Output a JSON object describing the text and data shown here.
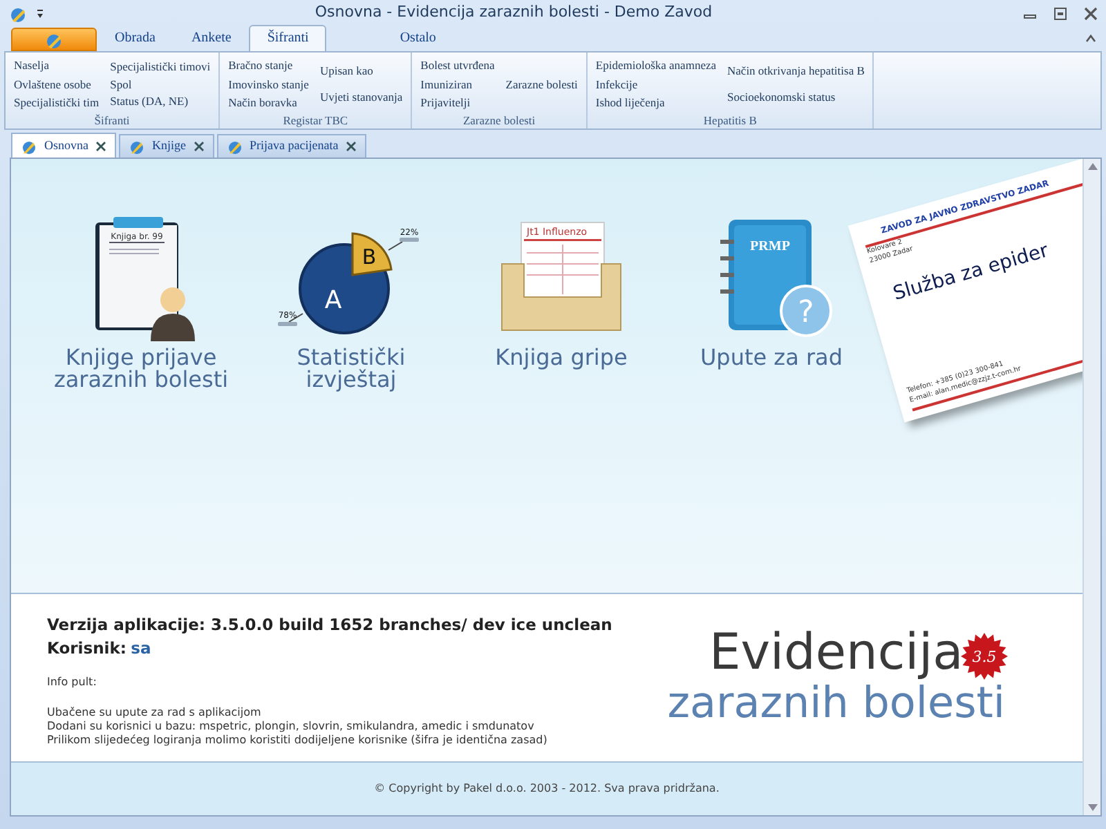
{
  "window": {
    "title": "Osnovna - Evidencija zaraznih bolesti - Demo Zavod"
  },
  "ribbon": {
    "tabs": [
      {
        "label": "Obrada",
        "selected": false
      },
      {
        "label": "Ankete",
        "selected": false
      },
      {
        "label": "Šifranti",
        "selected": true
      },
      {
        "label": "Ostalo",
        "selected": false
      }
    ],
    "groups": [
      {
        "label": "Šifranti",
        "columns": [
          [
            "Naselja",
            "Ovlaštene osobe",
            "Specijalistički tim"
          ],
          [
            "Specijalistički timovi",
            "Spol",
            "Status (DA, NE)"
          ]
        ]
      },
      {
        "label": "Registar TBC",
        "columns": [
          [
            "Bračno stanje",
            "Imovinsko stanje",
            "Način boravka"
          ],
          [
            "Upisan kao",
            "Uvjeti stanovanja"
          ]
        ]
      },
      {
        "label": "Zarazne bolesti",
        "columns": [
          [
            "Bolest utvrđena",
            "Imuniziran",
            "Prijavitelji"
          ],
          [
            "Zarazne bolesti"
          ]
        ]
      },
      {
        "label": "Hepatitis B",
        "columns": [
          [
            "Epidemiološka anamneza",
            "Infekcije",
            "Ishod liječenja"
          ],
          [
            "Način otkrivanja hepatitisa B",
            "Socioekonomski status"
          ]
        ]
      }
    ]
  },
  "document_tabs": [
    {
      "label": "Osnovna",
      "selected": true
    },
    {
      "label": "Knjige",
      "selected": false
    },
    {
      "label": "Prijava pacijenata",
      "selected": false
    }
  ],
  "tiles": [
    {
      "kind": "clipboard",
      "lines": [
        "Knjige prijave",
        "zaraznih bolesti"
      ],
      "icon_texts": [
        "Knjiga br. 99"
      ]
    },
    {
      "kind": "pie",
      "lines": [
        "Statistički",
        "izvještaj"
      ],
      "icon_texts": [
        "A",
        "B",
        "22%",
        "78%"
      ]
    },
    {
      "kind": "filebox",
      "lines": [
        "Knjiga gripe"
      ],
      "icon_texts": [
        "Jt1 Influenzo"
      ]
    },
    {
      "kind": "book",
      "lines": [
        "Upute za rad"
      ],
      "icon_texts": [
        "PRMP",
        "?"
      ]
    }
  ],
  "card": {
    "organization": "ZAVOD ZA JAVNO ZDRAVSTVO ZADAR",
    "address": [
      "Kolovare 2",
      "23000 Zadar"
    ],
    "headline": "Služba za epider",
    "contacts": [
      "Telefon: +385 (0)23 300-841",
      "E-mail: alan.medic@zzjz.t-com.hr"
    ]
  },
  "info": {
    "version": "Verzija aplikacije: 3.5.0.0 build 1652 branches/ dev ice unclean",
    "user_label": "Korisnik:",
    "user": "sa",
    "heading": "Info pult:",
    "lines": [
      "Ubačene su upute za rad s aplikacijom",
      "Dodani su korisnici u bazu: mspetric, plongin, slovrin, smikulandra, amedic i smdunatov",
      "Prilikom slijedećeg logiranja molimo koristiti dodijeljene korisnike (šifra je identična zasad)"
    ]
  },
  "logo": {
    "line1": "Evidencija",
    "line2": "zaraznih bolesti",
    "badge": "3.5"
  },
  "footer": "© Copyright by Pakel d.o.o. 2003 - 2012. Sva prava pridržana."
}
